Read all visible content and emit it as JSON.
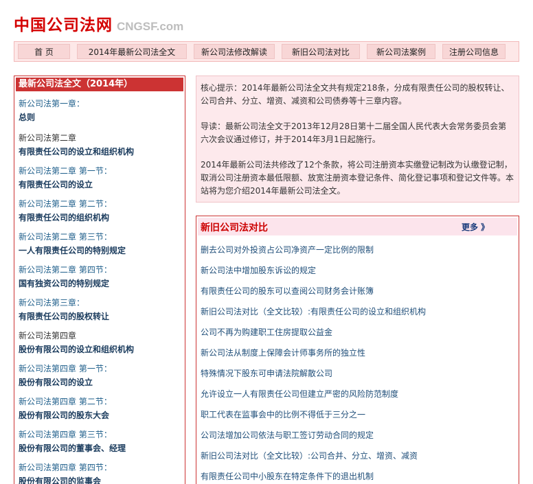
{
  "header": {
    "logo_cn": "中国公司法网",
    "logo_en": "CNGSF.com"
  },
  "nav": {
    "items": [
      "首 页",
      "2014年最新公司法全文",
      "新公司法修改解读",
      "新旧公司法对比",
      "新公司法案例",
      "注册公司信息"
    ]
  },
  "sidebar": {
    "title": "最新公司法全文（2014年）",
    "chapters": [
      {
        "label": "新公司法第一章：",
        "title": "总则"
      },
      {
        "label": "新公司法第二章",
        "title": "有限责任公司的设立和组织机构"
      },
      {
        "label": "新公司法第二章 第一节：",
        "title": "有限责任公司的设立"
      },
      {
        "label": "新公司法第二章 第二节：",
        "title": "有限责任公司的组织机构"
      },
      {
        "label": "新公司法第二章 第三节：",
        "title": "一人有限责任公司的特别规定"
      },
      {
        "label": "新公司法第二章 第四节：",
        "title": "国有独资公司的特别规定"
      },
      {
        "label": "新公司法第三章：",
        "title": "有限责任公司的股权转让"
      },
      {
        "label": "新公司法第四章",
        "title": "股份有限公司的设立和组织机构"
      },
      {
        "label": "新公司法第四章 第一节：",
        "title": "股份有限公司的设立"
      },
      {
        "label": "新公司法第四章 第二节：",
        "title": "股份有限公司的股东大会"
      },
      {
        "label": "新公司法第四章 第三节：",
        "title": "股份有限公司的董事会、经理"
      },
      {
        "label": "新公司法第四章 第四节：",
        "title": "股份有限公司的监事会"
      }
    ]
  },
  "notice": {
    "p1": "核心提示：2014年最新公司法全文共有规定218条，分成有限责任公司的股权转让、公司合并、分立、增资、减资和公司债券等十三章内容。",
    "p2": "导读：最新公司法全文于2013年12月28日第十二届全国人民代表大会常务委员会第六次会议通过修订，并于2014年3月1日起施行。",
    "p3": "2014年最新公司法共修改了12个条款，将公司注册资本实缴登记制改为认缴登记制，取消公司注册资本最低限额、放宽注册资本登记条件、简化登记事项和登记文件等。本站将为您介绍2014年最新公司法全文。"
  },
  "compare": {
    "title": "新旧公司法对比",
    "more": "更多 》",
    "items": [
      "删去公司对外投资占公司净资产一定比例的限制",
      "新公司法中增加股东诉讼的规定",
      "有限责任公司的股东可以查阅公司财务会计账簿",
      "新旧公司法对比（全文比较）:有限责任公司的设立和组织机构",
      "公司不再为购建职工住房提取公益金",
      "新公司法从制度上保障会计师事务所的独立性",
      "特殊情况下股东可申请法院解散公司",
      "允许设立一人有限责任公司但建立严密的风险防范制度",
      "职工代表在监事会中的比例不得低于三分之一",
      "公司法增加公司依法与职工签订劳动合同的规定",
      "新旧公司法对比（全文比较）:公司合并、分立、增资、减资",
      "有限责任公司中小股东在特定条件下的退出机制"
    ]
  }
}
